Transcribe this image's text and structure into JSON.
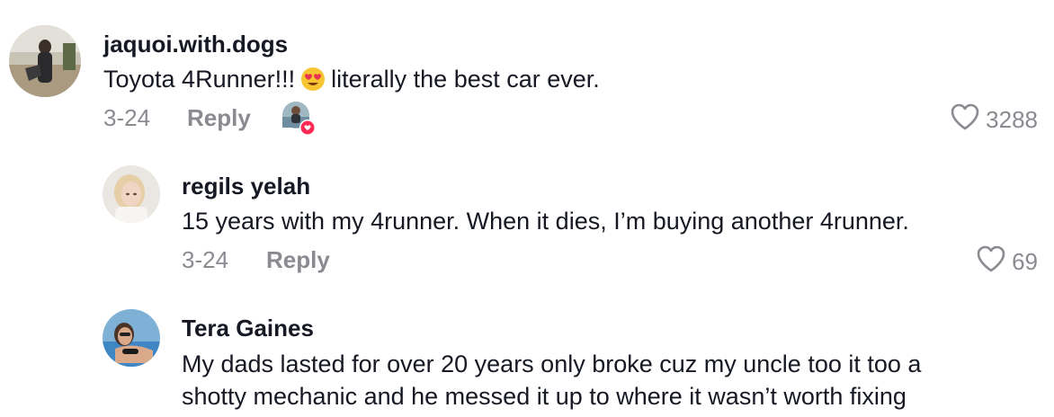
{
  "comments": [
    {
      "username": "jaquoi.with.dogs",
      "text_before": "Toyota 4Runner!!!",
      "emoji": "heart-eyes",
      "text_after": "literally the best car ever.",
      "date": "3-24",
      "reply_label": "Reply",
      "likes": "3288"
    },
    {
      "username": "regils yelah",
      "text": "15 years with my 4runner. When it dies, I’m buying another 4runner.",
      "date": "3-24",
      "reply_label": "Reply",
      "likes": "69"
    },
    {
      "username": "Tera Gaines",
      "text_line1": "My dads lasted for over 20 years only broke cuz my uncle too it too a",
      "text_line2": "shotty mechanic and he messed it up to where it wasn’t worth fixing"
    }
  ],
  "colors": {
    "text": "#161823",
    "meta": "#8a8b91",
    "like_badge": "#fe2c55",
    "emoji_face": "#f7c531",
    "emoji_heart": "#e8344e"
  }
}
